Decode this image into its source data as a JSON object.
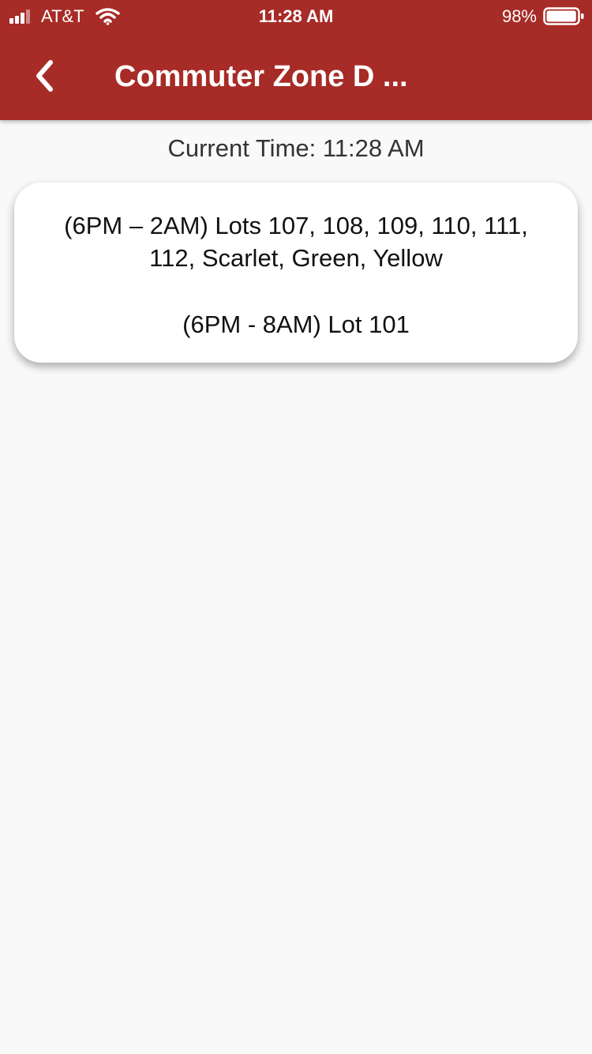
{
  "status_bar": {
    "carrier": "AT&T",
    "time": "11:28 AM",
    "battery": "98%",
    "signal_icon": "cellular-signal-icon",
    "wifi_icon": "wifi-icon",
    "battery_icon": "battery-icon",
    "battery_level": 0.98
  },
  "nav": {
    "title": "Commuter Zone D ...",
    "back_icon": "chevron-left-icon"
  },
  "current_time": {
    "text": "Current Time: 11:28 AM"
  },
  "card": {
    "line_1": "(6PM – 2AM) Lots 107, 108, 109, 110, 111,",
    "line_2": "112, Scarlet, Green, Yellow",
    "line_3": "(6PM - 8AM) Lot 101"
  },
  "colors": {
    "header": "#a72b26",
    "background": "#f9f9f9",
    "card": "#ffffff"
  }
}
